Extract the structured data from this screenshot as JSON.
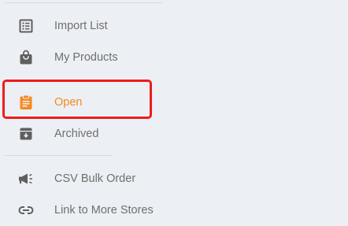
{
  "colors": {
    "background": "#eceff3",
    "text": "#6f6f6f",
    "icon": "#5f5f5f",
    "active": "#f58a1f",
    "highlight": "#ee1c1c"
  },
  "menu": {
    "items": [
      {
        "id": "import-list",
        "label": "Import List",
        "icon": "list-icon"
      },
      {
        "id": "my-products",
        "label": "My Products",
        "icon": "shopping-bag-icon"
      },
      {
        "id": "open",
        "label": "Open",
        "icon": "clipboard-icon",
        "active": true
      },
      {
        "id": "archived",
        "label": "Archived",
        "icon": "archive-box-icon"
      },
      {
        "id": "csv-bulk-order",
        "label": "CSV Bulk Order",
        "icon": "megaphone-icon"
      },
      {
        "id": "link-more-stores",
        "label": "Link to More Stores",
        "icon": "link-icon"
      }
    ]
  }
}
